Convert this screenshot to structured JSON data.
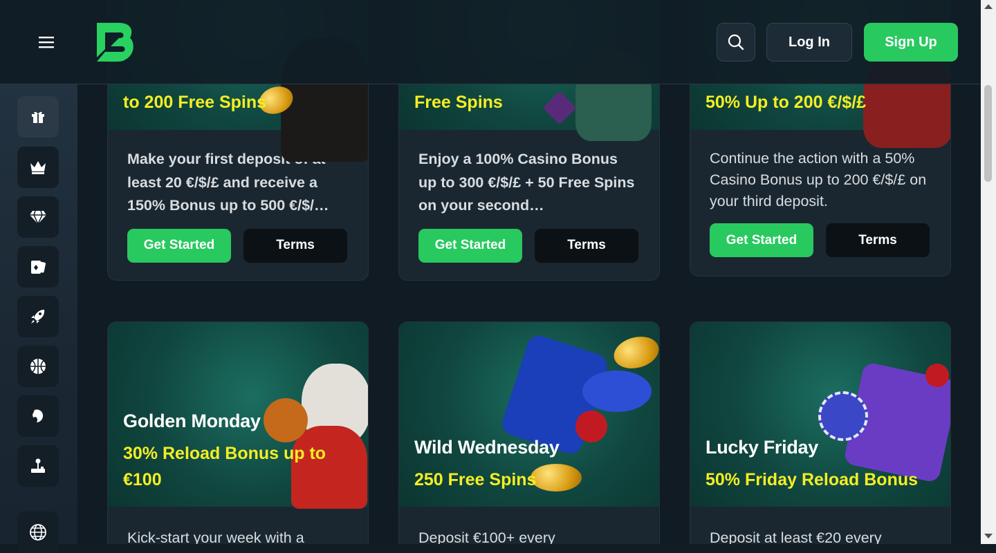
{
  "header": {
    "login_label": "Log In",
    "signup_label": "Sign Up"
  },
  "colors": {
    "accent_green": "#28c95f",
    "highlight_yellow": "#f4ee24",
    "background": "#111b23"
  },
  "sidebar": {
    "items": [
      {
        "icon": "gift-icon"
      },
      {
        "icon": "crown-icon"
      },
      {
        "icon": "diamond-icon"
      },
      {
        "icon": "cards-icon"
      },
      {
        "icon": "rocket-icon"
      },
      {
        "icon": "basketball-icon"
      },
      {
        "icon": "horse-icon"
      },
      {
        "icon": "joystick-icon"
      },
      {
        "icon": "globe-icon"
      }
    ]
  },
  "promos_top": [
    {
      "subtitle": "to 200 Free Spins",
      "description": "Make your first deposit of at least 20 €/$/£ and receive a 150% Bonus up to 500 €/$/…",
      "primary": "Get Started",
      "secondary": "Terms"
    },
    {
      "subtitle": "Free Spins",
      "description": "Enjoy a 100% Casino Bonus up to 300 €/$/£ + 50 Free Spins on your second…",
      "primary": "Get Started",
      "secondary": "Terms"
    },
    {
      "subtitle": "50% Up to 200 €/$/£",
      "description": "Continue the action with a 50% Casino Bonus up to 200 €/$/£ on your third deposit.",
      "primary": "Get Started",
      "secondary": "Terms"
    }
  ],
  "promos_bottom": [
    {
      "title": "Golden Monday",
      "subtitle": "30% Reload Bonus up to €100",
      "description": "Kick-start your week with a"
    },
    {
      "title": "Wild Wednesday",
      "subtitle": "250 Free Spins",
      "description": "Deposit €100+ every"
    },
    {
      "title": "Lucky Friday",
      "subtitle": "50% Friday Reload Bonus",
      "description": "Deposit at least €20 every"
    }
  ]
}
